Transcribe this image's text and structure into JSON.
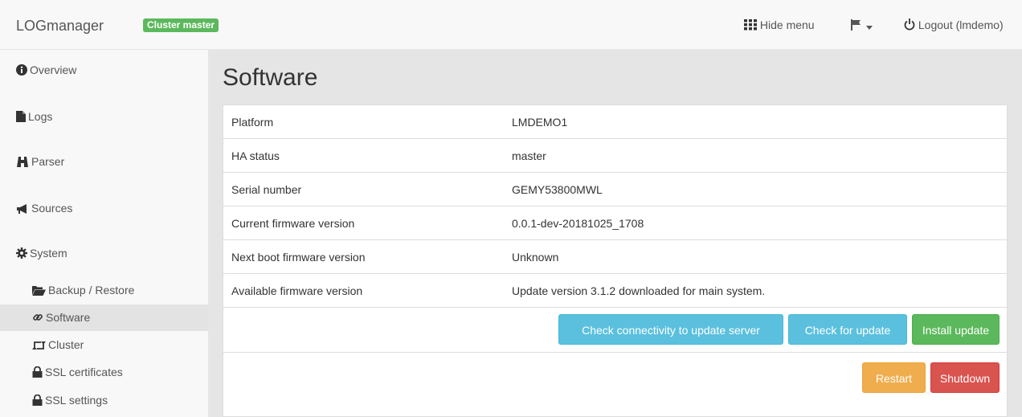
{
  "app": {
    "brand": "LOGmanager",
    "badge": "Cluster master",
    "badge_color": "#5cb85c"
  },
  "topnav": {
    "hide_menu": "Hide menu",
    "logout": "Logout (lmdemo)",
    "flag_icon": "flag-icon",
    "grid_icon": "grid-icon",
    "power_icon": "power-icon"
  },
  "sidebar": {
    "items": [
      {
        "label": "Overview",
        "icon": "info-circle-icon"
      },
      {
        "label": "Logs",
        "icon": "file-icon"
      },
      {
        "label": "Parser",
        "icon": "binoculars-icon"
      },
      {
        "label": "Sources",
        "icon": "megaphone-icon"
      },
      {
        "label": "System",
        "icon": "gear-icon"
      }
    ],
    "sub_items": [
      {
        "label": "Backup / Restore",
        "icon": "folder-open-icon"
      },
      {
        "label": "Software",
        "icon": "link-icon",
        "active": true
      },
      {
        "label": "Cluster",
        "icon": "retweet-icon"
      },
      {
        "label": "SSL certificates",
        "icon": "lock-icon"
      },
      {
        "label": "SSL settings",
        "icon": "lock-icon"
      }
    ]
  },
  "main": {
    "title": "Software",
    "rows": [
      {
        "label": "Platform",
        "value": "LMDEMO1"
      },
      {
        "label": "HA status",
        "value": "master"
      },
      {
        "label": "Serial number",
        "value": "GEMY53800MWL"
      },
      {
        "label": "Current firmware version",
        "value": "0.0.1-dev-20181025_1708"
      },
      {
        "label": "Next boot firmware version",
        "value": "Unknown"
      },
      {
        "label": "Available firmware version",
        "value": "Update version 3.1.2 downloaded for main system."
      }
    ],
    "buttons": {
      "check_connectivity": "Check connectivity to update server",
      "check_update": "Check for update",
      "install_update": "Install update",
      "restart": "Restart",
      "shutdown": "Shutdown"
    }
  },
  "colors": {
    "info": "#5bc0de",
    "success": "#5cb85c",
    "warning": "#f0ad4e",
    "danger": "#d9534f"
  }
}
